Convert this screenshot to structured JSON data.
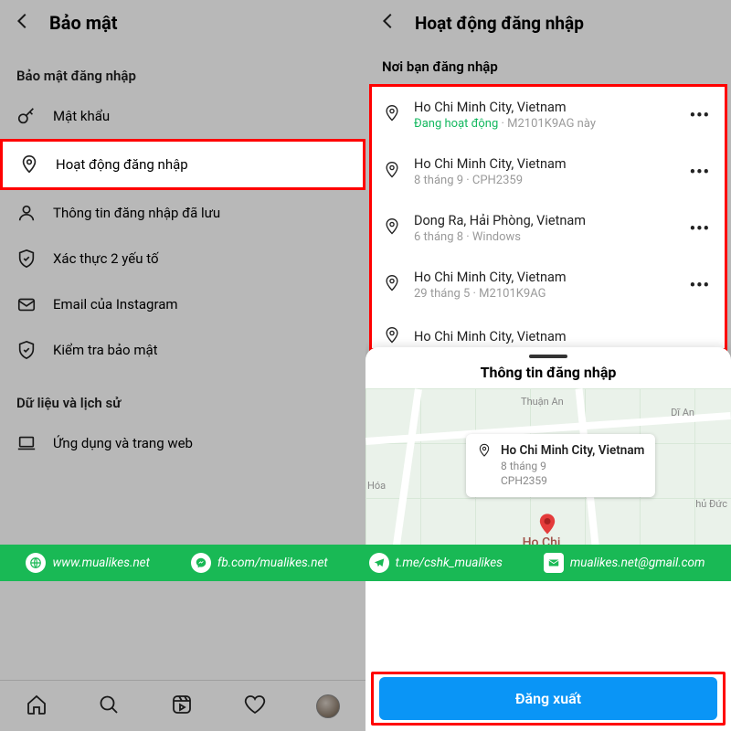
{
  "left": {
    "title": "Bảo mật",
    "section_login": "Bảo mật đăng nhập",
    "items": [
      {
        "label": "Mật khẩu"
      },
      {
        "label": "Hoạt động đăng nhập"
      },
      {
        "label": "Thông tin đăng nhập đã lưu"
      },
      {
        "label": "Xác thực 2 yếu tố"
      },
      {
        "label": "Email của Instagram"
      },
      {
        "label": "Kiểm tra bảo mật"
      }
    ],
    "section_data": "Dữ liệu và lịch sử",
    "data_items": [
      {
        "label": "Ứng dụng và trang web"
      }
    ]
  },
  "right": {
    "title": "Hoạt động đăng nhập",
    "sub": "Nơi bạn đăng nhập",
    "sessions": [
      {
        "loc": "Ho Chi Minh City, Vietnam",
        "active_label": "Đang hoạt động",
        "meta_rest": " · M2101K9AG này"
      },
      {
        "loc": "Ho Chi Minh City, Vietnam",
        "meta": "8 tháng 9 · CPH2359"
      },
      {
        "loc": "Dong Ra, Hải Phòng, Vietnam",
        "meta": "6 tháng 8 · Windows"
      },
      {
        "loc": "Ho Chi Minh City, Vietnam",
        "meta": "29 tháng 5 · M2101K9AG"
      },
      {
        "loc": "Ho Chi Minh City, Vietnam",
        "meta": ""
      }
    ],
    "sheet_title": "Thông tin đăng nhập",
    "map_card": {
      "loc": "Ho Chi Minh City, Vietnam",
      "date": "8 tháng 9",
      "device": "CPH2359"
    },
    "map_labels": {
      "thuan_an": "Thuận An",
      "di_an": "Dĩ An",
      "hoa": "Hóa",
      "thu_duc": "hủ Đức",
      "city": "Ho Chi\nMinh City"
    },
    "logout": "Đăng xuất"
  },
  "contact": {
    "web": "www.mualikes.net",
    "fb": "fb.com/mualikes.net",
    "tg": "t.me/cshk_mualikes",
    "mail": "mualikes.net@gmail.com"
  }
}
